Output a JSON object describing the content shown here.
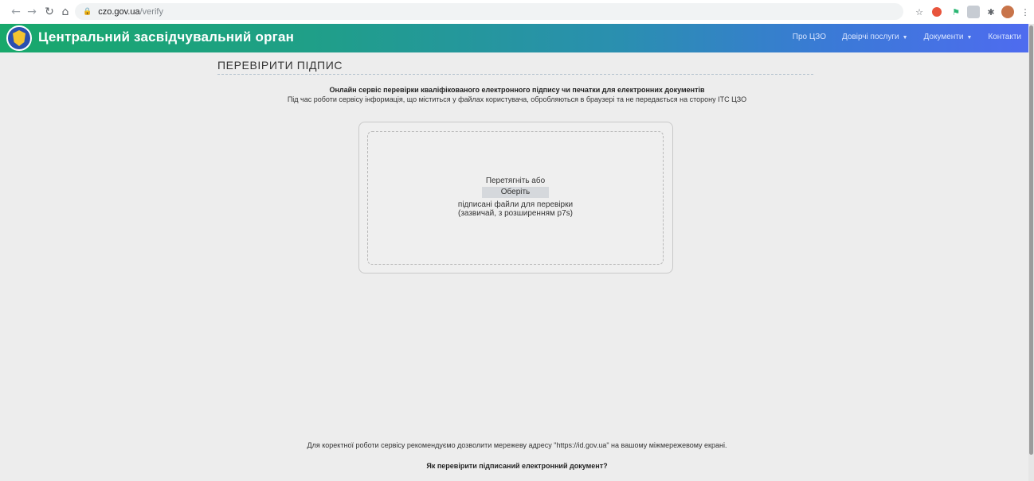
{
  "browser": {
    "url_domain": "czo.gov.ua",
    "url_path": "/verify",
    "icons": [
      "back-icon",
      "forward-icon",
      "reload-icon",
      "home-icon",
      "lock-icon",
      "star-icon",
      "extensions-icon",
      "menu-icon"
    ]
  },
  "header": {
    "title": "Центральний засвідчувальний орган",
    "nav": [
      {
        "label": "Про ЦЗО"
      },
      {
        "label": "Довірчі послуги"
      },
      {
        "label": "Документи"
      },
      {
        "label": "Контакти"
      }
    ]
  },
  "main": {
    "title": "ПЕРЕВІРИТИ ПІДПИС",
    "intro_bold": "Онлайн сервіс перевірки кваліфікованого електронного підпису чи печатки для електронних документів",
    "intro_text": "Під час роботи сервісу інформація, що міститься у файлах користувача, обробляються в браузері та не передається на сторону ІТС ЦЗО",
    "drop": {
      "drag_text": "Перетягніть або",
      "choose_button": "Оберіть",
      "line1": "підписані файли для перевірки",
      "line2": "(зазвичай, з розширенням p7s)"
    }
  },
  "footer": {
    "note": "Для коректної роботи сервісу рекомендуємо дозволити мережеву адресу \"https://id.gov.ua\" на вашому міжмережевому екрані.",
    "link": "Як перевірити підписаний електронний документ?"
  },
  "colors": {
    "header_start": "#18a86b",
    "header_end": "#4f6bf0",
    "background": "#ededed"
  }
}
